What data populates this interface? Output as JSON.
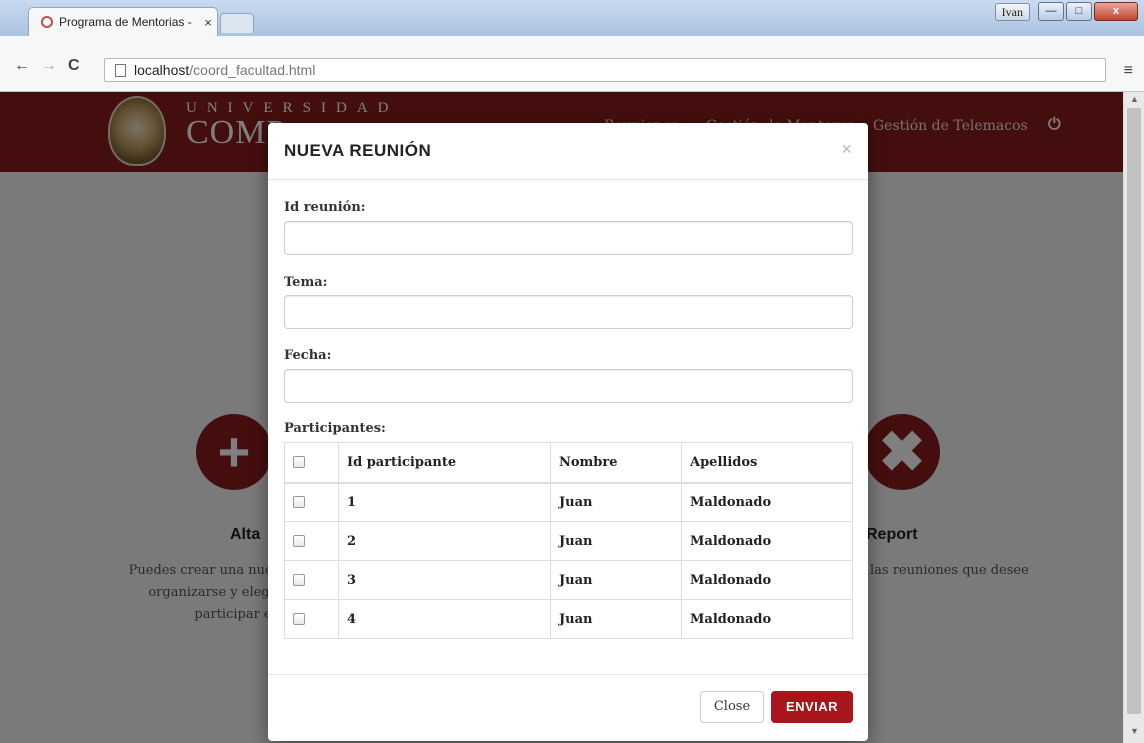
{
  "window": {
    "user_badge": "Ivan",
    "minimize": "—",
    "maximize": "□",
    "close": "x"
  },
  "tab": {
    "title": "Programa de Mentorias - ",
    "close": "×"
  },
  "toolbar": {
    "back": "←",
    "forward": "→",
    "reload": "C",
    "url_host": "localhost",
    "url_path": "/coord_facultad.html",
    "menu": "≡"
  },
  "site": {
    "brand_top": "UNIVERSIDAD",
    "brand_bottom": "COMP",
    "nav_links": [
      "Reuniones",
      "Gestión de Mentores",
      "Gestión de Telemacos"
    ],
    "power_icon": "⏻"
  },
  "features": {
    "left": {
      "icon": "+",
      "title": "Alta",
      "lines": [
        "Puedes crear una nuev",
        "organizarse y elegir",
        "participar en"
      ]
    },
    "right": {
      "icon": "✖",
      "title": "Report",
      "lines": [
        "las reuniones que desee"
      ]
    }
  },
  "modal": {
    "title": "NUEVA REUNIÓN",
    "close": "×",
    "fields": {
      "id_label": "Id reunión:",
      "id_value": "",
      "tema_label": "Tema:",
      "tema_value": "",
      "fecha_label": "Fecha:",
      "fecha_value": ""
    },
    "participants_label": "Participantes:",
    "table": {
      "headers": [
        "Id participante",
        "Nombre",
        "Apellidos"
      ],
      "rows": [
        {
          "id": "1",
          "nombre": "Juan",
          "apellidos": "Maldonado",
          "checked": false
        },
        {
          "id": "2",
          "nombre": "Juan",
          "apellidos": "Maldonado",
          "checked": false
        },
        {
          "id": "3",
          "nombre": "Juan",
          "apellidos": "Maldonado",
          "checked": false
        },
        {
          "id": "4",
          "nombre": "Juan",
          "apellidos": "Maldonado",
          "checked": false
        }
      ]
    },
    "buttons": {
      "close": "Close",
      "send": "ENVIAR"
    }
  },
  "colors": {
    "brand": "#8b1c1c",
    "primary_button": "#a9151b"
  }
}
